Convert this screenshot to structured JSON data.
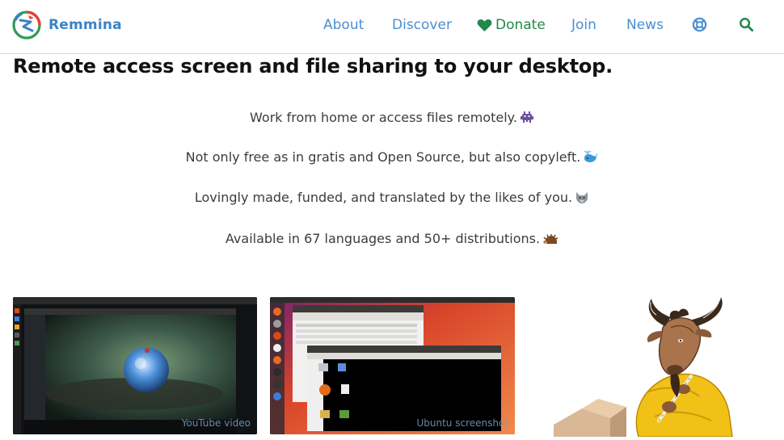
{
  "brand": {
    "name": "Remmina",
    "logo_icon": "remmina-logo-icon"
  },
  "nav": {
    "about": "About",
    "discover": "Discover",
    "donate": "Donate",
    "join": "Join",
    "news": "News",
    "support_icon": "lifebuoy-icon",
    "search_icon": "search-icon"
  },
  "main": {
    "headline": "Remote access screen and file sharing to your desktop.",
    "taglines": [
      {
        "text": "Work from home or access files remotely.",
        "emoji_icon": "alien-monster-icon"
      },
      {
        "text": "Not only free as in gratis and Open Source, but also copyleft.",
        "emoji_icon": "spouting-whale-icon"
      },
      {
        "text": "Lovingly made, funded, and translated by the likes of you.",
        "emoji_icon": "wolf-icon"
      },
      {
        "text": "Available in 67 languages and 50+ distributions.",
        "emoji_icon": "hedgehog-icon"
      }
    ]
  },
  "gallery": {
    "youtube_caption": "YouTube video",
    "ubuntu_caption": "Ubuntu screenshot",
    "mascot_icon": "gnu-mascot-icon"
  },
  "colors": {
    "link": "#4a8fcf",
    "donate": "#22884b",
    "brand": "#3a84c5",
    "ubuntu_orange": "#e95420"
  }
}
